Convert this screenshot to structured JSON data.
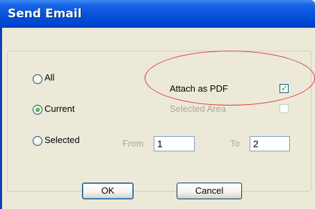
{
  "window": {
    "title": "Send Email"
  },
  "range": {
    "all_label": "All",
    "current_label": "Current",
    "selected_label": "Selected",
    "selected_option": "Current"
  },
  "options": {
    "attach_pdf_label": "Attach as PDF",
    "attach_pdf_checked": true,
    "selected_area_label": "Selected Area",
    "selected_area_checked": false
  },
  "pages": {
    "from_label": "From",
    "from_value": "1",
    "to_label": "To",
    "to_value": "2"
  },
  "buttons": {
    "ok_label": "OK",
    "cancel_label": "Cancel"
  },
  "annotation": {
    "color": "#e03a3a"
  }
}
